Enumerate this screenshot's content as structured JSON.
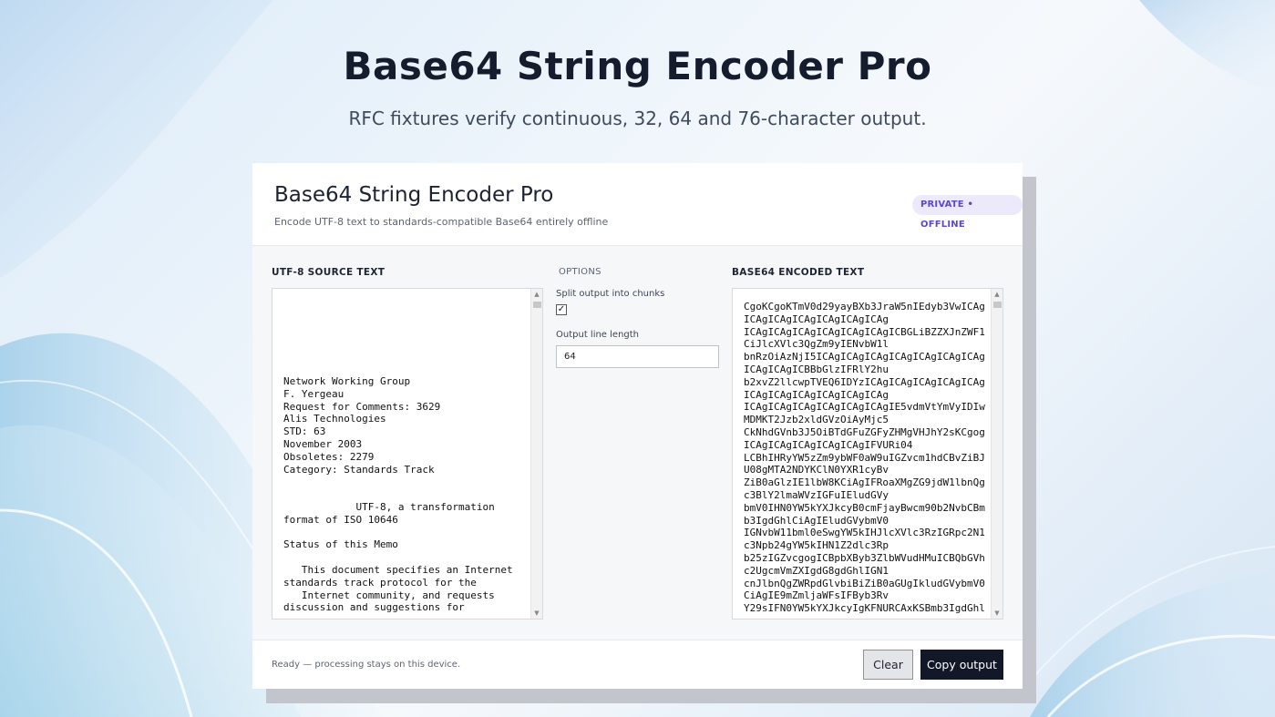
{
  "hero": {
    "title": "Base64 String Encoder Pro",
    "subtitle": "RFC fixtures verify continuous, 32, 64 and 76-character output."
  },
  "app": {
    "title": "Base64 String Encoder Pro",
    "subtitle": "Encode UTF-8 text to standards-compatible Base64 entirely offline",
    "badge": "PRIVATE • OFFLINE"
  },
  "source": {
    "label": "UTF-8 SOURCE TEXT",
    "text": "Network Working Group\nF. Yergeau\nRequest for Comments: 3629\nAlis Technologies\nSTD: 63\nNovember 2003\nObsoletes: 2279\nCategory: Standards Track\n\n\n            UTF-8, a transformation\nformat of ISO 10646\n\nStatus of this Memo\n\n   This document specifies an Internet\nstandards track protocol for the\n   Internet community, and requests\ndiscussion and suggestions for"
  },
  "options": {
    "label": "OPTIONS",
    "split_label": "Split output into chunks",
    "split_checked": true,
    "split_mark": "✓",
    "line_length_label": "Output line length",
    "line_length_value": "64"
  },
  "output": {
    "label": "BASE64 ENCODED TEXT",
    "text": "CgoKCgoKTmV0d29yayBXb3JraW5nIEdyb3VwICAg\nICAgICAgICAgICAgICAgICAg\nICAgICAgICAgICAgICAgICAgICBGLiBZZXJnZWF1\nCiJlcXVlc3QgZm9yIENvbW1l\nbnRzOiAzNjI5ICAgICAgICAgICAgICAgICAgICAg\nICAgICAgICBBbGlzIFRlY2hu\nb2xvZ2llcwpTVEQ6IDYzICAgICAgICAgICAgICAg\nICAgICAgICAgICAgICAgICAg\nICAgICAgICAgICAgICAgICAgIE5vdmVtYmVyIDIw\nMDMKT2Jzb2xldGVzOiAyMjc5\nCkNhdGVnb3J5OiBTdGFuZGFyZHMgVHJhY2sKCgog\nICAgICAgICAgICAgICAgIFVURi04\nLCBhIHRyYW5zZm9ybWF0aW9uIGZvcm1hdCBvZiBJ\nU08gMTA2NDYKClN0YXR1cyBv\nZiB0aGlzIE1lbW8KCiAgIFRoaXMgZG9jdW1lbnQg\nc3BlY2lmaWVzIGFuIEludGVy\nbmV0IHN0YW5kYXJkcyB0cmFjayBwcm90b2NvbCBm\nb3IgdGhlCiAgIEludGVybmV0\nIGNvbW11bml0eSwgYW5kIHJlcXVlc3RzIGRpc2N1\nc3Npb24gYW5kIHN1Z2dlc3Rp\nb25zIGZvcgogICBpbXByb3ZlbWVudHMuICBQbGVh\nc2UgcmVmZXIgdG8gdGhlIGN1\ncnJlbnQgZWRpdGlvbiBiZiB0aGUgIkludGVybmV0\nCiAgIE9mZmljaWFsIFByb3Rv\nY29sIFN0YW5kYXJkcyIgKFNURCAxKSBmb3IgdGhl"
  },
  "footer": {
    "status": "Ready — processing stays on this device.",
    "clear_label": "Clear",
    "copy_label": "Copy output"
  },
  "colors": {
    "accent_dark": "#121827",
    "badge_bg": "#ece9fb",
    "badge_text": "#5a49c8"
  }
}
